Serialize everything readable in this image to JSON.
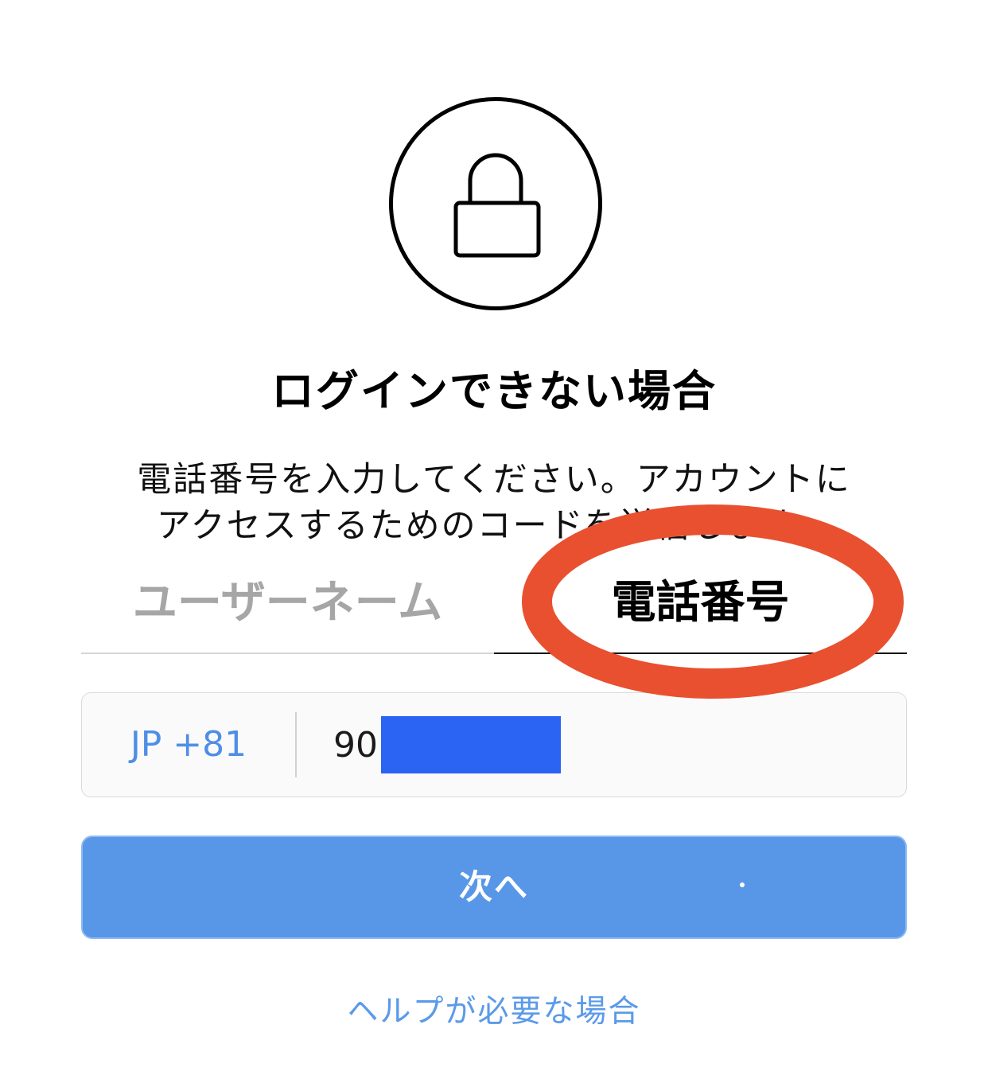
{
  "header": {
    "title": "ログインできない場合",
    "description": "電話番号を入力してください。アカウントにアクセスするためのコードを送信します。"
  },
  "icons": {
    "lock": "lock-icon"
  },
  "tabs": [
    {
      "label": "ユーザーネーム",
      "active": false
    },
    {
      "label": "電話番号",
      "active": true
    }
  ],
  "phone": {
    "country_code": "JP +81",
    "value_prefix": "90"
  },
  "actions": {
    "next_label": "次へ",
    "help_label": "ヘルプが必要な場合"
  },
  "colors": {
    "accent": "#5897e8",
    "link": "#5b9ae9",
    "country_code": "#4f8ee6",
    "annotation": "#e9502f",
    "redaction": "#2b63f2"
  }
}
